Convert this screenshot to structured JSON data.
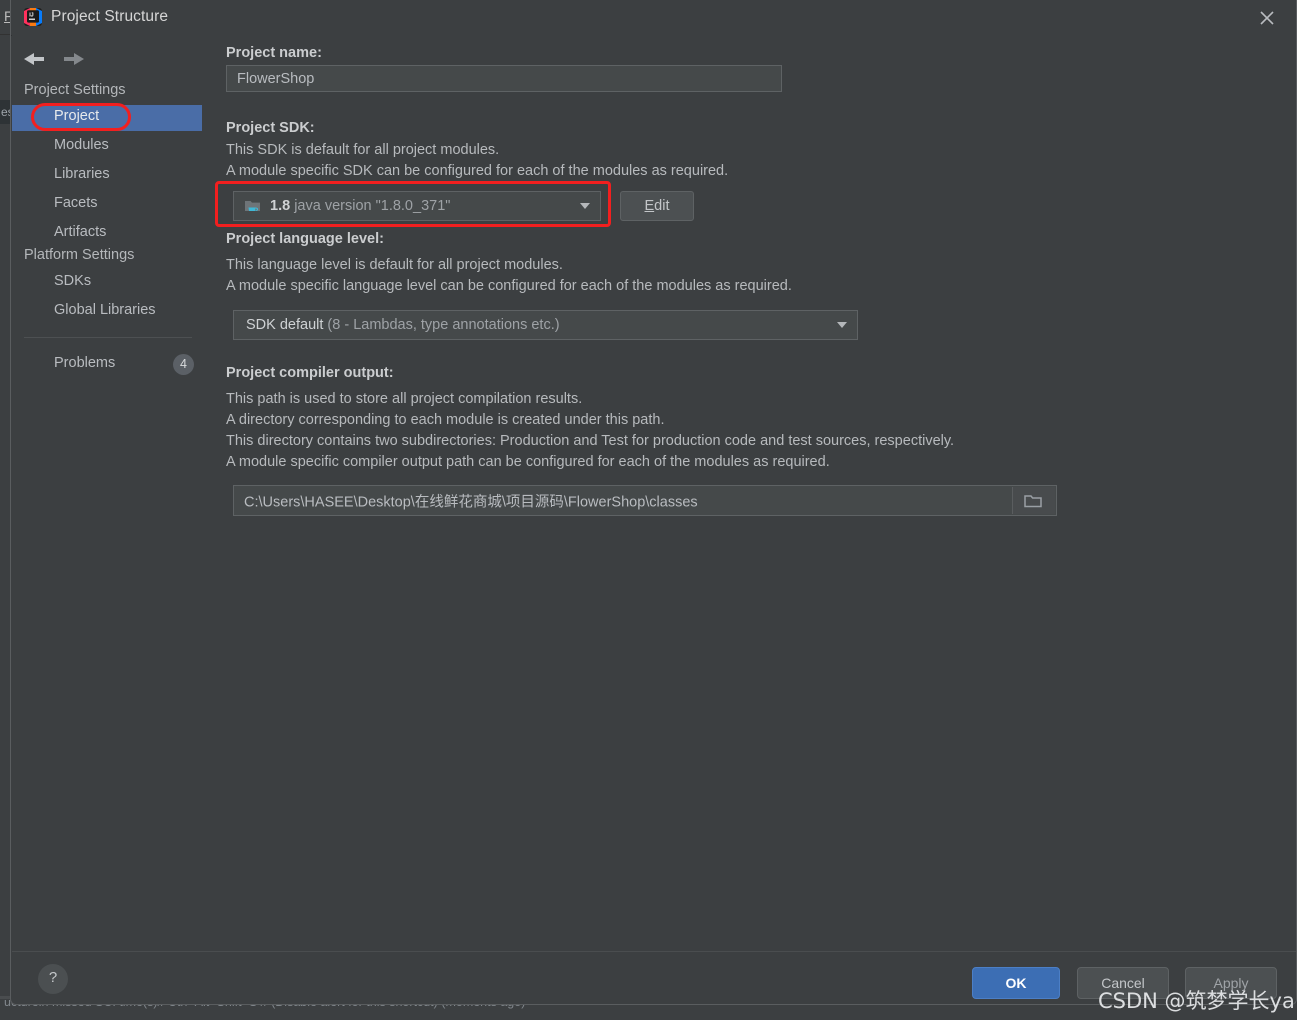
{
  "window": {
    "title": "Project Structure",
    "close_label": "×",
    "app_icon": "intellij-idea-icon"
  },
  "ide_background": {
    "menu_first_letter": "F",
    "left_tab_fragment": "es",
    "status_fragment": "uctureln missed SCI time(s)// Ctrl+Alt+Shift+S // (Disable alert for this shortcut) (moments ago)"
  },
  "sidebar": {
    "nav": {
      "back_label": "back-arrow",
      "forward_label": "forward-arrow"
    },
    "groups": [
      {
        "header": "Project Settings",
        "items": [
          {
            "label": "Project",
            "selected": true
          },
          {
            "label": "Modules",
            "selected": false
          },
          {
            "label": "Libraries",
            "selected": false
          },
          {
            "label": "Facets",
            "selected": false
          },
          {
            "label": "Artifacts",
            "selected": false
          }
        ]
      },
      {
        "header": "Platform Settings",
        "items": [
          {
            "label": "SDKs",
            "selected": false
          },
          {
            "label": "Global Libraries",
            "selected": false
          }
        ]
      }
    ],
    "problems": {
      "label": "Problems",
      "count": "4"
    }
  },
  "main": {
    "project_name": {
      "title": "Project name:",
      "value": "FlowerShop"
    },
    "project_sdk": {
      "title": "Project SDK:",
      "desc_line1": "This SDK is default for all project modules.",
      "desc_line2": "A module specific SDK can be configured for each of the modules as required.",
      "selected_version": "1.8",
      "selected_detail": "java version \"1.8.0_371\"",
      "edit_label_prefix": "",
      "edit_label_accel": "E",
      "edit_label_rest": "dit"
    },
    "language_level": {
      "title": "Project language level:",
      "desc_line1": "This language level is default for all project modules.",
      "desc_line2": "A module specific language level can be configured for each of the modules as required.",
      "selected_main": "SDK default",
      "selected_detail": "(8 - Lambdas, type annotations etc.)"
    },
    "compiler_output": {
      "title": "Project compiler output:",
      "desc_line1": "This path is used to store all project compilation results.",
      "desc_line2": "A directory corresponding to each module is created under this path.",
      "desc_line3": "This directory contains two subdirectories: Production and Test for production code and test sources, respectively.",
      "desc_line4": "A module specific compiler output path can be configured for each of the modules as required.",
      "path_value": "C:\\Users\\HASEE\\Desktop\\在线鲜花商城\\项目源码\\FlowerShop\\classes",
      "browse_icon": "folder-open-icon"
    }
  },
  "footer": {
    "help_label": "?",
    "ok_label": "OK",
    "cancel_label": "Cancel",
    "apply_label": "Apply"
  },
  "watermark": {
    "text": "CSDN @筑梦学长ya"
  },
  "colors": {
    "dialog_bg": "#3c3f41",
    "selection_blue": "#4a6da7",
    "ok_button_blue": "#3c6eb4",
    "annotation_red": "#f21f1f",
    "field_bg": "#45494a"
  }
}
